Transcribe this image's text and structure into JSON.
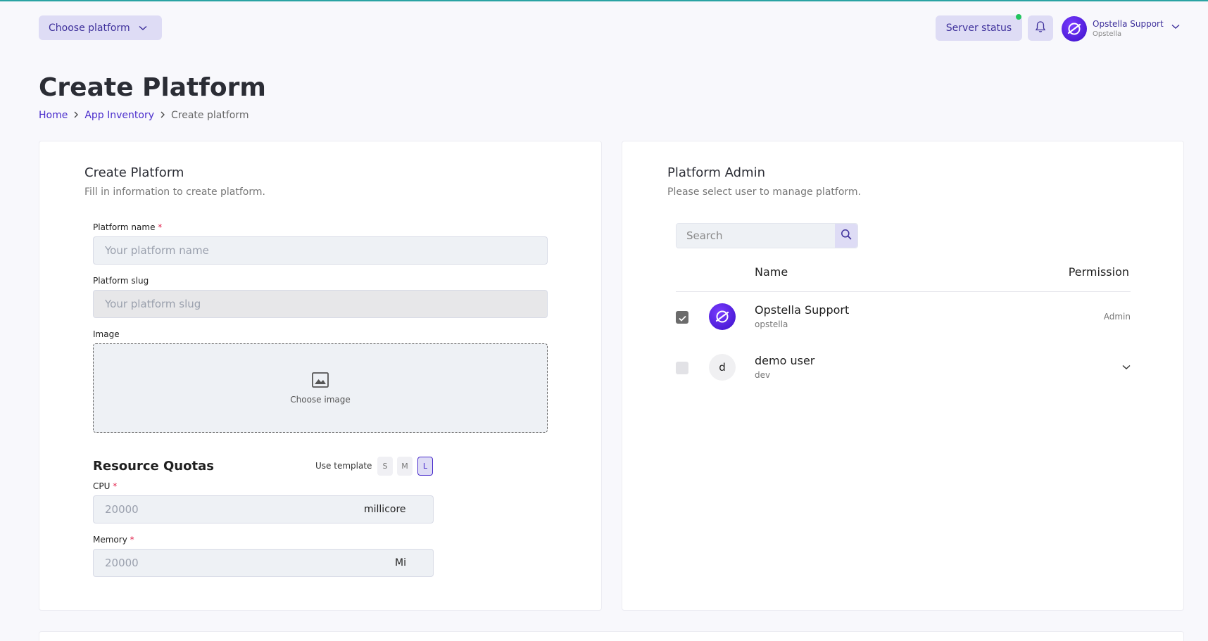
{
  "header": {
    "choose_platform_label": "Choose platform",
    "server_status_label": "Server status",
    "user_name": "Opstella Support",
    "user_org": "Opstella"
  },
  "page": {
    "title": "Create Platform",
    "breadcrumb": [
      "Home",
      "App Inventory",
      "Create platform"
    ]
  },
  "create_form": {
    "title": "Create Platform",
    "subtitle": "Fill in information to create platform.",
    "platform_name_label": "Platform name",
    "platform_name_placeholder": "Your platform name",
    "platform_slug_label": "Platform slug",
    "platform_slug_placeholder": "Your platform slug",
    "image_label": "Image",
    "choose_image_label": "Choose image",
    "resource_quotas_title": "Resource Quotas",
    "use_template_label": "Use template",
    "templates": [
      "S",
      "M",
      "L"
    ],
    "active_template": "L",
    "cpu_label": "CPU",
    "cpu_placeholder": "20000",
    "cpu_unit": "millicore",
    "memory_label": "Memory",
    "memory_placeholder": "20000",
    "memory_unit": "Mi"
  },
  "platform_admin": {
    "title": "Platform Admin",
    "subtitle": "Please select user to manage platform.",
    "search_placeholder": "Search",
    "columns": [
      "Name",
      "Permission"
    ],
    "users": [
      {
        "name": "Opstella Support",
        "handle": "opstella",
        "permission": "Admin",
        "checked": true,
        "avatar": "logo"
      },
      {
        "name": "demo user",
        "handle": "dev",
        "permission": "",
        "checked": false,
        "avatar": "d"
      }
    ]
  },
  "colors": {
    "accent": "#4a2dcc",
    "accent_bg": "#dedcf5",
    "status_online": "#22c55e",
    "required": "#e11d48"
  },
  "icons": [
    "chevron-down-icon",
    "bell-icon",
    "opstella-logo-icon",
    "image-icon",
    "search-icon",
    "check-icon",
    "chevron-right-icon"
  ]
}
